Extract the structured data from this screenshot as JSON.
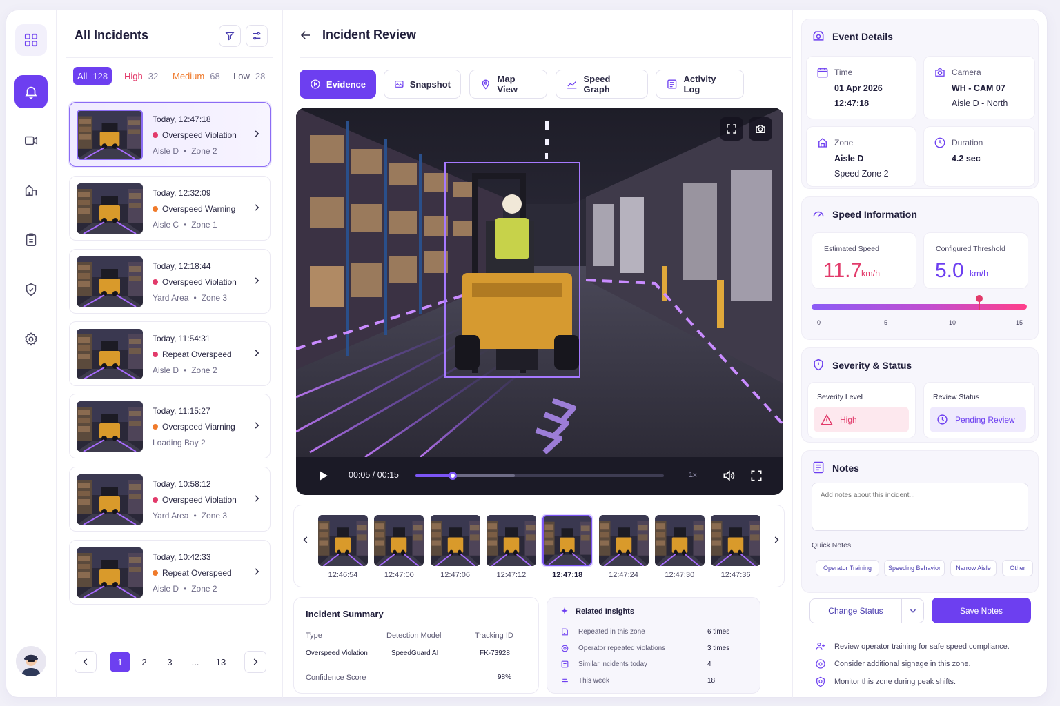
{
  "incidents_panel": {
    "title": "All Incidents",
    "filters": [
      {
        "label": "All",
        "count": "128"
      },
      {
        "label": "High",
        "count": "32"
      },
      {
        "label": "Medium",
        "count": "68"
      },
      {
        "label": "Low",
        "count": "28"
      }
    ],
    "items": [
      {
        "time": "Today, 12:47:18",
        "type": "Overspeed Violation",
        "loc_a": "Aisle D",
        "loc_b": "Zone 2",
        "dot": "#e23a6a"
      },
      {
        "time": "Today, 12:32:09",
        "type": "Overspeed Warning",
        "loc_a": "Aisle C",
        "loc_b": "Zone 1",
        "dot": "#f07a2a"
      },
      {
        "time": "Today, 12:18:44",
        "type": "Overspeed Violation",
        "loc_a": "Yard Area",
        "loc_b": "Zone 3",
        "dot": "#e23a6a"
      },
      {
        "time": "Today, 11:54:31",
        "type": "Repeat Overspeed",
        "loc_a": "Aisle D",
        "loc_b": "Zone 2",
        "dot": "#e23a6a"
      },
      {
        "time": "Today, 11:15:27",
        "type": "Overspeed Viarning",
        "loc_a": "Loading Bay 2",
        "loc_b": "",
        "dot": "#f07a2a"
      },
      {
        "time": "Today, 10:58:12",
        "type": "Overspeed Violation",
        "loc_a": "Yard Area",
        "loc_b": "Zone 3",
        "dot": "#e23a6a"
      },
      {
        "time": "Today, 10:42:33",
        "type": "Repeat Overspeed",
        "loc_a": "Aisle D",
        "loc_b": "Zone 2",
        "dot": "#f07a2a"
      }
    ],
    "pagination": [
      "1",
      "2",
      "3",
      "...",
      "13"
    ]
  },
  "review": {
    "title": "Incident Review",
    "tabs": [
      "Evidence",
      "Snapshot",
      "Map View",
      "Speed Graph",
      "Activity Log"
    ],
    "player": {
      "time": "00:05 / 00:15",
      "speed": "1x",
      "progress": 0.15
    },
    "frames": [
      "12:46:54",
      "12:47:00",
      "12:47:06",
      "12:47:12",
      "12:47:18",
      "12:47:24",
      "12:47:30",
      "12:47:36"
    ],
    "summary": {
      "title": "Incident Summary",
      "headers": [
        "Type",
        "Detection Model",
        "Tracking ID"
      ],
      "values": [
        "Overspeed Violation",
        "SpeedGuard AI",
        "FK-73928"
      ],
      "confidence_label": "Confidence Score",
      "confidence_value": "98%"
    },
    "insights": {
      "title": "Related Insights",
      "rows": [
        {
          "label": "Repeated in this zone",
          "value": "6 times"
        },
        {
          "label": "Operator repeated violations",
          "value": "3 times"
        },
        {
          "label": "Similar incidents today",
          "value": "4"
        },
        {
          "label": "This week",
          "value": "18"
        }
      ]
    }
  },
  "event": {
    "title": "Event Details",
    "time_label": "Time",
    "date": "01 Apr 2026",
    "time": "12:47:18",
    "camera_label": "Camera",
    "camera": "WH - CAM 07",
    "camera_loc": "Aisle D - North",
    "zone_label": "Zone",
    "zone": "Aisle D",
    "zone_sub": "Speed Zone 2",
    "duration_label": "Duration",
    "duration": "4.2 sec"
  },
  "speed": {
    "title": "Speed Information",
    "est_label": "Estimated Speed",
    "est_value": "11.7",
    "est_unit": "km/h",
    "thr_label": "Configured Threshold",
    "thr_value": "5.0",
    "thr_unit": "km/h",
    "scale": [
      "0",
      "5",
      "10",
      "15"
    ],
    "marker_value": 11.7,
    "scale_max": 15
  },
  "severity": {
    "title": "Severity & Status",
    "level_label": "Severity Level",
    "level": "High",
    "status_label": "Review Status",
    "status": "Pending Review"
  },
  "notes": {
    "title": "Notes",
    "placeholder": "Add notes about this incident...",
    "quick_label": "Quick Notes",
    "chips": [
      "Operator Training",
      "Speeding Behavior",
      "Narrow Aisle",
      "Other"
    ],
    "change_status": "Change Status",
    "save": "Save Notes",
    "tips": [
      "Review operator training for safe speed compliance.",
      "Consider additional signage in this zone.",
      "Monitor this zone during peak shifts."
    ]
  },
  "colors": {
    "accent": "#6d3ff0",
    "high": "#e23a6a",
    "medium": "#ef7a2c"
  }
}
